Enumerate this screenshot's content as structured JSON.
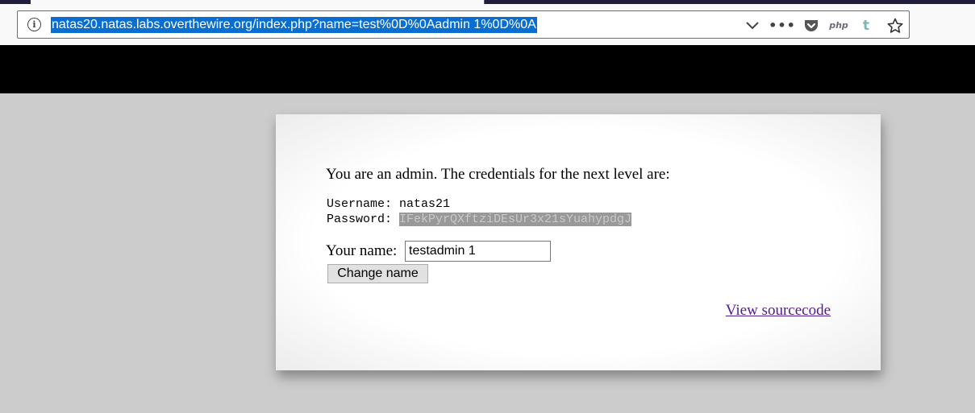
{
  "browser": {
    "url": "natas20.natas.labs.overthewire.org/index.php?name=test%0D%0Aadmin 1%0D%0A",
    "icons": [
      "info-icon",
      "chevron-down-icon",
      "more-dots-icon",
      "pocket-icon",
      "php-icon",
      "tumblr-icon",
      "star-icon"
    ],
    "php_label": "php",
    "tumblr_label": "t",
    "dots_label": "•••",
    "accent_color": "#0a84ff"
  },
  "content": {
    "message": "You are an admin. The credentials for the next level are:",
    "username_label": "Username: ",
    "username": "natas21",
    "password_label": "Password: ",
    "password": "IFekPyrQXftziDEsUr3x21sYuahypdgJ",
    "name_label": "Your name:",
    "name_value": "testadmin 1",
    "button_label": "Change name",
    "view_source_label": "View sourcecode"
  }
}
